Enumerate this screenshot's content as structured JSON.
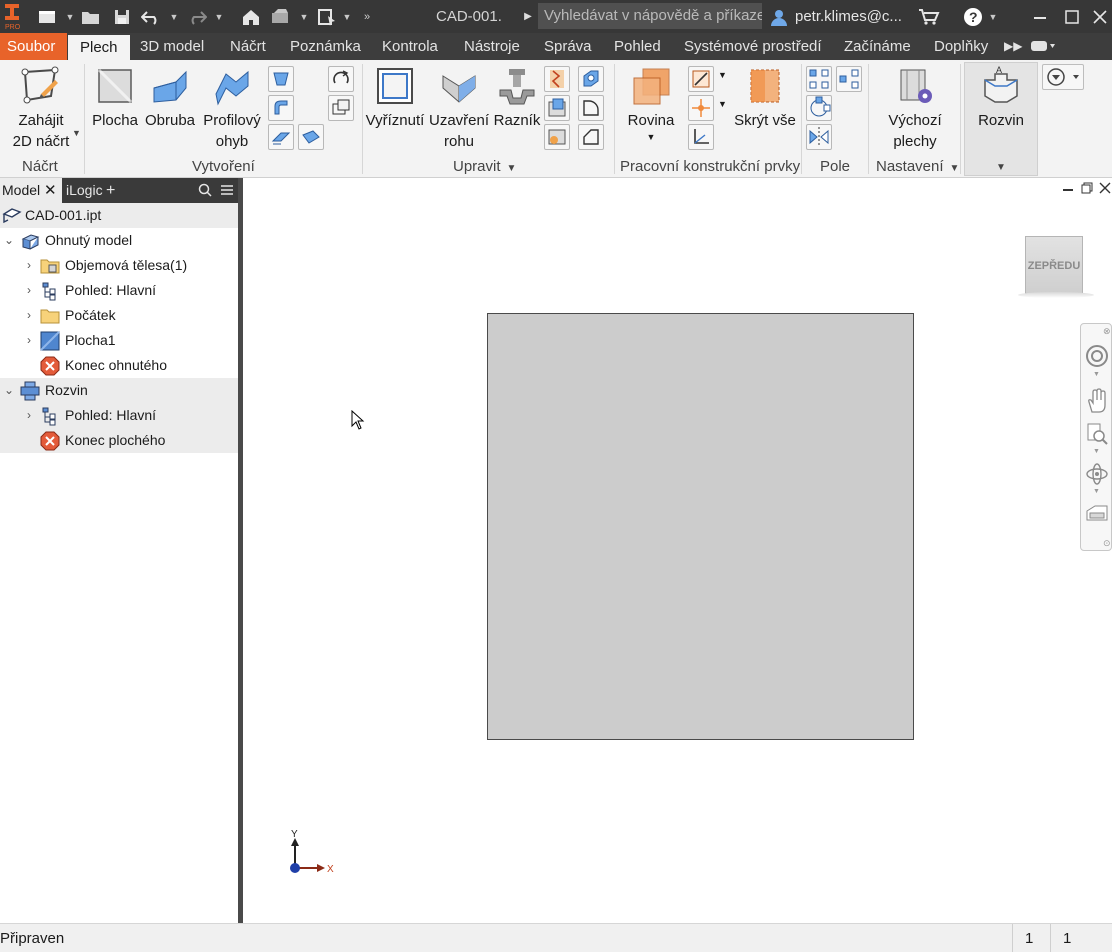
{
  "titlebar": {
    "app_logo_text": "PRO",
    "document_title": "CAD-001.",
    "search_placeholder": "Vyhledávat v nápovědě a příkazech",
    "user_name": "petr.klimes@c..."
  },
  "tabs": [
    {
      "label": "Soubor"
    },
    {
      "label": "Plech"
    },
    {
      "label": "3D model"
    },
    {
      "label": "Náčrt"
    },
    {
      "label": "Poznámka"
    },
    {
      "label": "Kontrola"
    },
    {
      "label": "Nástroje"
    },
    {
      "label": "Správa"
    },
    {
      "label": "Pohled"
    },
    {
      "label": "Systémové prostředí"
    },
    {
      "label": "Začínáme"
    },
    {
      "label": "Doplňky"
    }
  ],
  "ribbon": {
    "sketch": {
      "btn_line1": "Zahájit",
      "btn_line2": "2D náčrt",
      "panel": "Náčrt"
    },
    "create": {
      "plocha": "Plocha",
      "obruba": "Obruba",
      "profil_line1": "Profilový",
      "profil_line2": "ohyb",
      "panel": "Vytvoření"
    },
    "modify": {
      "vyriznuti": "Vyříznutí",
      "uzavreni_line1": "Uzavření",
      "uzavreni_line2": "rohu",
      "raznik": "Razník",
      "panel": "Upravit"
    },
    "workfeatures": {
      "rovina": "Rovina",
      "skryt": "Skrýt vše",
      "panel": "Pracovní konstrukční prvky"
    },
    "pattern": {
      "panel": "Pole"
    },
    "setup": {
      "vychozi_line1": "Výchozí",
      "vychozi_line2": "plechy",
      "panel": "Nastavení"
    },
    "flat": {
      "rozvin": "Rozvin"
    }
  },
  "browser": {
    "tab_model": "Model",
    "tab_ilogic": "iLogic",
    "nodes": [
      {
        "label": "CAD-001.ipt"
      },
      {
        "label": "Ohnutý model"
      },
      {
        "label": "Objemová tělesa(1)"
      },
      {
        "label": "Pohled: Hlavní"
      },
      {
        "label": "Počátek"
      },
      {
        "label": "Plocha1"
      },
      {
        "label": "Konec ohnutého"
      },
      {
        "label": "Rozvin"
      },
      {
        "label": "Pohled: Hlavní"
      },
      {
        "label": "Konec plochého"
      }
    ]
  },
  "graphics": {
    "viewcube_label": "ZEPŘEDU",
    "axis_y": "Y",
    "axis_x": "X"
  },
  "status": {
    "text": "Připraven",
    "count1": "1",
    "count2": "1"
  },
  "colors": {
    "file_tab": "#e8632a",
    "accent_orange": "#f08a3c",
    "icon_blue": "#3d78c8",
    "flat_plate": "#cccccc"
  }
}
